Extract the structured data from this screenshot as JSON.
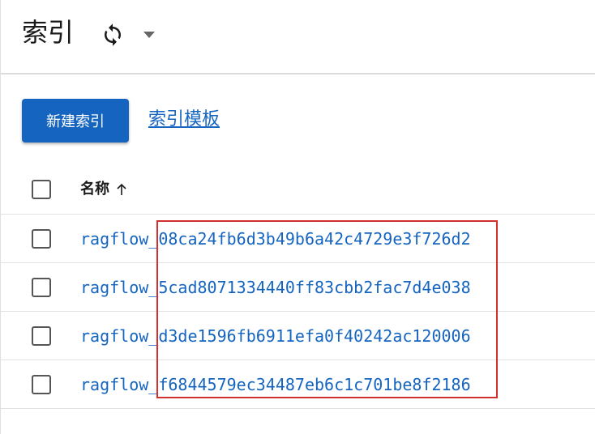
{
  "header": {
    "title": "索引",
    "refresh_icon": "refresh-icon",
    "dropdown_icon": "caret-down-icon"
  },
  "actions": {
    "create_button": "新建索引",
    "template_link": "索引模板"
  },
  "table": {
    "columns": {
      "name": "名称",
      "sort_icon": "arrow-up-icon",
      "sort_direction": "ascending"
    },
    "rows": [
      {
        "name": "ragflow_08ca24fb6d3b49b6a42c4729e3f726d2",
        "selected": false
      },
      {
        "name": "ragflow_5cad8071334440ff83cbb2fac7d4e038",
        "selected": false
      },
      {
        "name": "ragflow_d3de1596fb6911efa0f40242ac120006",
        "selected": false
      },
      {
        "name": "ragflow_f6844579ec34487eb6c1c701be8f2186",
        "selected": false
      }
    ]
  },
  "colors": {
    "primary": "#1565c0",
    "highlight": "#d32f2f"
  }
}
